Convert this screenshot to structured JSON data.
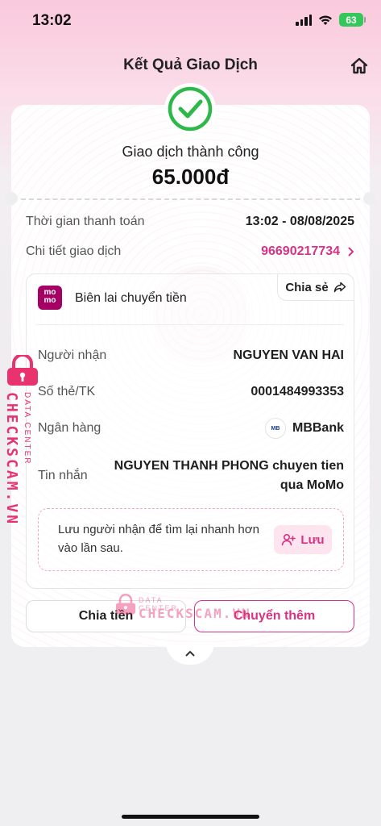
{
  "status_bar": {
    "time": "13:02",
    "battery": "63"
  },
  "header": {
    "title": "Kết Quả Giao Dịch"
  },
  "result": {
    "status_text": "Giao dịch thành công",
    "amount": "65.000đ"
  },
  "details": {
    "time_label": "Thời gian thanh toán",
    "time_value": "13:02 - 08/08/2025",
    "txn_label": "Chi tiết giao dịch",
    "txn_value": "96690217734"
  },
  "receipt": {
    "logo_text_top": "mo",
    "logo_text_bottom": "mo",
    "title": "Biên lai chuyển tiền",
    "share_label": "Chia sẻ",
    "rows": {
      "recipient_label": "Người nhận",
      "recipient_value": "NGUYEN VAN HAI",
      "account_label": "Số thẻ/TK",
      "account_value": "0001484993353",
      "bank_label": "Ngân hàng",
      "bank_value": "MBBank",
      "bank_icon_text": "MB",
      "message_label": "Tin nhắn",
      "message_value": "NGUYEN THANH PHONG chuyen tien qua MoMo"
    },
    "save_prompt": "Lưu người nhận để tìm lại nhanh hơn vào lần sau.",
    "save_label": "Lưu"
  },
  "actions": {
    "split_label": "Chia tiền",
    "transfer_more_label": "Chuyển thêm"
  },
  "watermark": {
    "small": "DATA CENTER",
    "big": "CHECKSCAM.VN"
  },
  "colors": {
    "accent": "#d63384",
    "success": "#2eb84b",
    "watermark": "#e8336f"
  },
  "icons": [
    "signal-icon",
    "wifi-icon",
    "battery-icon",
    "home-icon",
    "check-circle-icon",
    "share-icon",
    "add-user-icon",
    "chevron-up-icon",
    "chevron-right-icon",
    "lock-icon"
  ]
}
